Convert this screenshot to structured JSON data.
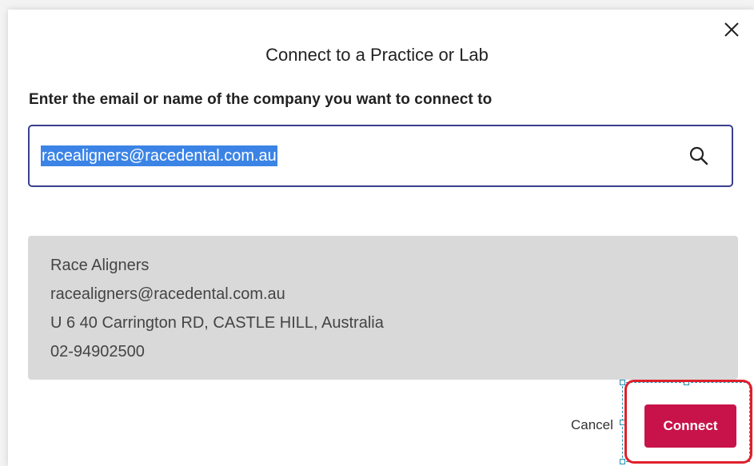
{
  "dialog": {
    "title": "Connect to a Practice or Lab",
    "close_icon": "close-icon"
  },
  "instruction": "Enter the email or name of the company you want to connect to",
  "search": {
    "value": "racealigners@racedental.com.au",
    "icon": "search-icon",
    "border_color": "#3a3f8f",
    "selection_color": "#3b84e6"
  },
  "result": {
    "name": "Race Aligners",
    "email": "racealigners@racedental.com.au",
    "address": "U 6 40 Carrington RD, CASTLE HILL, Australia",
    "phone": "02-94902500"
  },
  "actions": {
    "cancel_label": "Cancel",
    "connect_label": "Connect",
    "connect_color": "#c8134a",
    "highlight_color": "#e0202b"
  }
}
